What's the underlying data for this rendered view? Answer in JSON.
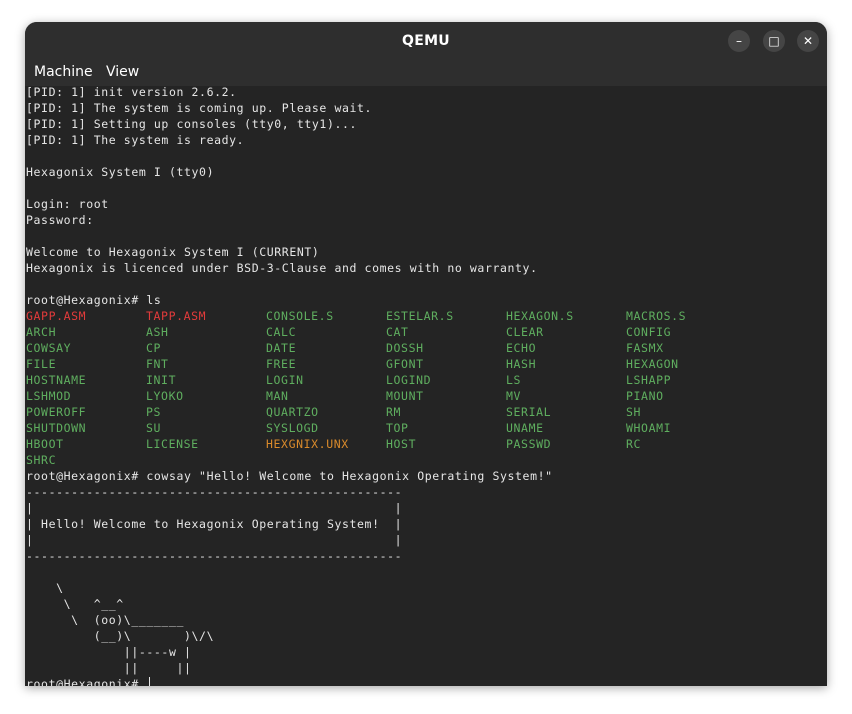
{
  "window": {
    "title": "QEMU",
    "buttons": {
      "minimize": "–",
      "maximize": "□",
      "close": "✕"
    }
  },
  "menu": {
    "machine": "Machine",
    "view": "View"
  },
  "colors": {
    "default": "#e6e6e6",
    "green": "#5fae5f",
    "red": "#e23b3b",
    "orange": "#d98a2b"
  },
  "terminal": {
    "boot_lines": [
      "[PID: 1] init version 2.6.2.",
      "[PID: 1] The system is coming up. Please wait.",
      "[PID: 1] Setting up consoles (tty0, tty1)...",
      "[PID: 1] The system is ready.",
      "",
      "Hexagonix System I (tty0)",
      "",
      "Login: root",
      "Password:",
      "",
      "Welcome to Hexagonix System I (CURRENT)",
      "Hexagonix is licenced under BSD-3-Clause and comes with no warranty.",
      "",
      "root@Hexagonix# ls"
    ],
    "ls_rows": [
      [
        {
          "t": "GAPP.ASM",
          "c": "red"
        },
        {
          "t": "TAPP.ASM",
          "c": "red"
        },
        {
          "t": "CONSOLE.S",
          "c": "green"
        },
        {
          "t": "ESTELAR.S",
          "c": "green"
        },
        {
          "t": "HEXAGON.S",
          "c": "green"
        },
        {
          "t": "MACROS.S",
          "c": "green"
        }
      ],
      [
        {
          "t": "ARCH",
          "c": "green"
        },
        {
          "t": "ASH",
          "c": "green"
        },
        {
          "t": "CALC",
          "c": "green"
        },
        {
          "t": "CAT",
          "c": "green"
        },
        {
          "t": "CLEAR",
          "c": "green"
        },
        {
          "t": "CONFIG",
          "c": "green"
        }
      ],
      [
        {
          "t": "COWSAY",
          "c": "green"
        },
        {
          "t": "CP",
          "c": "green"
        },
        {
          "t": "DATE",
          "c": "green"
        },
        {
          "t": "DOSSH",
          "c": "green"
        },
        {
          "t": "ECHO",
          "c": "green"
        },
        {
          "t": "FASMX",
          "c": "green"
        }
      ],
      [
        {
          "t": "FILE",
          "c": "green"
        },
        {
          "t": "FNT",
          "c": "green"
        },
        {
          "t": "FREE",
          "c": "green"
        },
        {
          "t": "GFONT",
          "c": "green"
        },
        {
          "t": "HASH",
          "c": "green"
        },
        {
          "t": "HEXAGON",
          "c": "green"
        }
      ],
      [
        {
          "t": "HOSTNAME",
          "c": "green"
        },
        {
          "t": "INIT",
          "c": "green"
        },
        {
          "t": "LOGIN",
          "c": "green"
        },
        {
          "t": "LOGIND",
          "c": "green"
        },
        {
          "t": "LS",
          "c": "green"
        },
        {
          "t": "LSHAPP",
          "c": "green"
        }
      ],
      [
        {
          "t": "LSHMOD",
          "c": "green"
        },
        {
          "t": "LYOKO",
          "c": "green"
        },
        {
          "t": "MAN",
          "c": "green"
        },
        {
          "t": "MOUNT",
          "c": "green"
        },
        {
          "t": "MV",
          "c": "green"
        },
        {
          "t": "PIANO",
          "c": "green"
        }
      ],
      [
        {
          "t": "POWEROFF",
          "c": "green"
        },
        {
          "t": "PS",
          "c": "green"
        },
        {
          "t": "QUARTZO",
          "c": "green"
        },
        {
          "t": "RM",
          "c": "green"
        },
        {
          "t": "SERIAL",
          "c": "green"
        },
        {
          "t": "SH",
          "c": "green"
        }
      ],
      [
        {
          "t": "SHUTDOWN",
          "c": "green"
        },
        {
          "t": "SU",
          "c": "green"
        },
        {
          "t": "SYSLOGD",
          "c": "green"
        },
        {
          "t": "TOP",
          "c": "green"
        },
        {
          "t": "UNAME",
          "c": "green"
        },
        {
          "t": "WHOAMI",
          "c": "green"
        }
      ],
      [
        {
          "t": "HBOOT",
          "c": "green"
        },
        {
          "t": "LICENSE",
          "c": "green"
        },
        {
          "t": "HEXGNIX.UNX",
          "c": "orange"
        },
        {
          "t": "HOST",
          "c": "green"
        },
        {
          "t": "PASSWD",
          "c": "green"
        },
        {
          "t": "RC",
          "c": "green"
        }
      ],
      [
        {
          "t": "SHRC",
          "c": "green"
        }
      ]
    ],
    "after_lines": [
      "root@Hexagonix# cowsay \"Hello! Welcome to Hexagonix Operating System!\"",
      "--------------------------------------------------",
      "|                                                |",
      "| Hello! Welcome to Hexagonix Operating System!  |",
      "|                                                |",
      "--------------------------------------------------",
      "",
      "    \\",
      "     \\   ^__^",
      "      \\  (oo)\\_______",
      "         (__)\\       )\\/\\",
      "             ||----w |",
      "             ||     ||"
    ],
    "prompt": "root@Hexagonix# "
  }
}
